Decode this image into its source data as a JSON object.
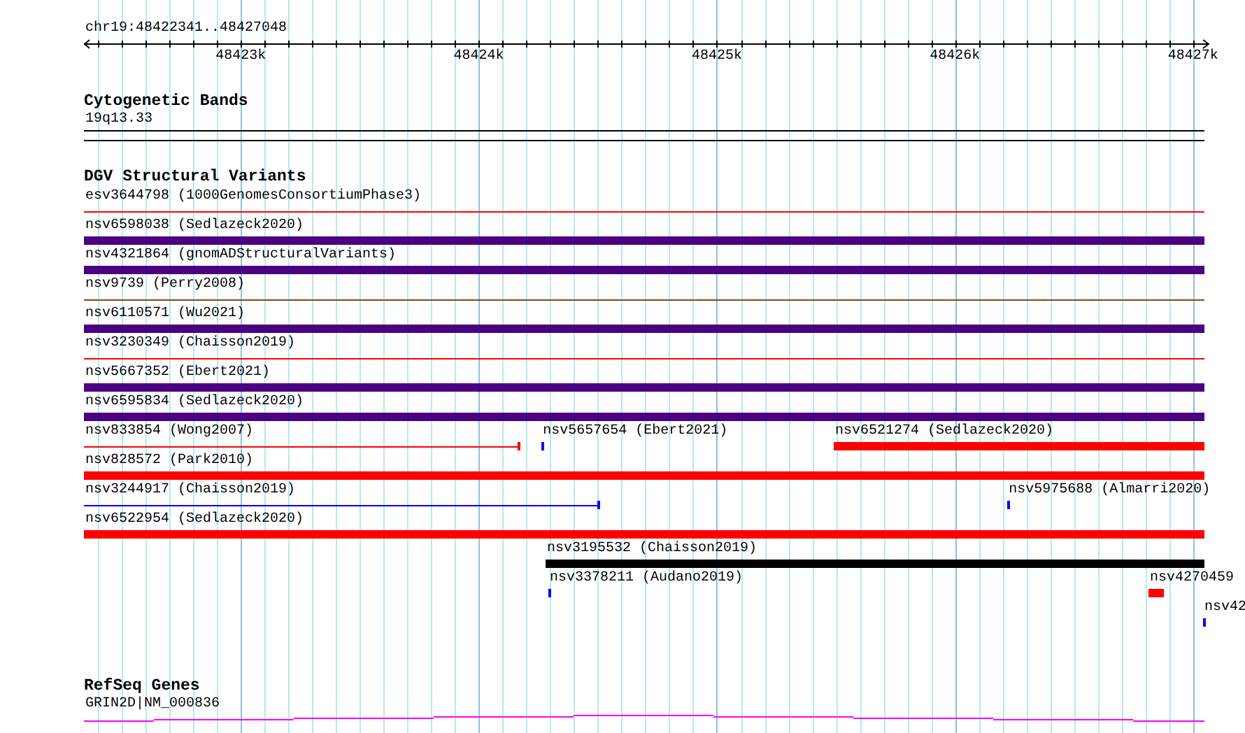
{
  "ruler": {
    "location": "chr19:48422341..48427048",
    "ticks": [
      {
        "label": "48423k"
      },
      {
        "label": "48424k"
      },
      {
        "label": "48425k"
      },
      {
        "label": "48426k"
      },
      {
        "label": "48427k"
      }
    ]
  },
  "cytoband_track": {
    "title": "Cytogenetic Bands",
    "band": "19q13.33"
  },
  "variant_track": {
    "title": "DGV Structural Variants",
    "lanes": [
      {
        "features": [
          {
            "label": "esv3644798 (1000GenomesConsortiumPhase3)",
            "kind": "line",
            "color": "#ff0000"
          }
        ]
      },
      {
        "features": [
          {
            "label": "nsv6598038 (Sedlazeck2020)",
            "kind": "bar",
            "color": "#4b0082"
          }
        ]
      },
      {
        "features": [
          {
            "label": "nsv4321864 (gnomADStructuralVariants)",
            "kind": "bar",
            "color": "#4b0082"
          }
        ]
      },
      {
        "features": [
          {
            "label": "nsv9739 (Perry2008)",
            "kind": "line",
            "color": "#8b4513"
          }
        ]
      },
      {
        "features": [
          {
            "label": "nsv6110571 (Wu2021)",
            "kind": "bar",
            "color": "#4b0082"
          }
        ]
      },
      {
        "features": [
          {
            "label": "nsv3230349 (Chaisson2019)",
            "kind": "line",
            "color": "#ff0000"
          }
        ]
      },
      {
        "features": [
          {
            "label": "nsv5667352 (Ebert2021)",
            "kind": "bar",
            "color": "#4b0082"
          }
        ]
      },
      {
        "features": [
          {
            "label": "nsv6595834 (Sedlazeck2020)",
            "kind": "bar",
            "color": "#4b0082"
          }
        ]
      },
      {
        "features": [
          {
            "label": "nsv833854 (Wong2007)",
            "kind": "capped-line",
            "color": "#ff0000"
          },
          {
            "label": "nsv5657654 (Ebert2021)",
            "kind": "bar",
            "color": "#0000ff"
          },
          {
            "label": "nsv6521274 (Sedlazeck2020)",
            "kind": "bar",
            "color": "#ff0000"
          }
        ]
      },
      {
        "features": [
          {
            "label": "nsv828572 (Park2010)",
            "kind": "bar",
            "color": "#ff0000"
          }
        ]
      },
      {
        "features": [
          {
            "label": "nsv3244917 (Chaisson2019)",
            "kind": "capped-line",
            "color": "#0000ff"
          },
          {
            "label": "nsv5975688 (Almarri2020)",
            "kind": "bar",
            "color": "#0000ff"
          }
        ]
      },
      {
        "features": [
          {
            "label": "nsv6522954 (Sedlazeck2020)",
            "kind": "bar",
            "color": "#ff0000"
          }
        ]
      },
      {
        "features": [
          {
            "label": "nsv3195532 (Chaisson2019)",
            "kind": "bar",
            "color": "#000000"
          }
        ]
      },
      {
        "features": [
          {
            "label": "nsv3378211 (Audano2019)",
            "kind": "bar",
            "color": "#0000ff"
          },
          {
            "label": "nsv4270459",
            "kind": "bar",
            "color": "#ff0000"
          }
        ]
      },
      {
        "features": [
          {
            "label": "nsv42",
            "kind": "bar",
            "color": "#0000ff"
          }
        ]
      }
    ]
  },
  "gene_track": {
    "title": "RefSeq Genes",
    "gene": "GRIN2D|NM_000836"
  }
}
